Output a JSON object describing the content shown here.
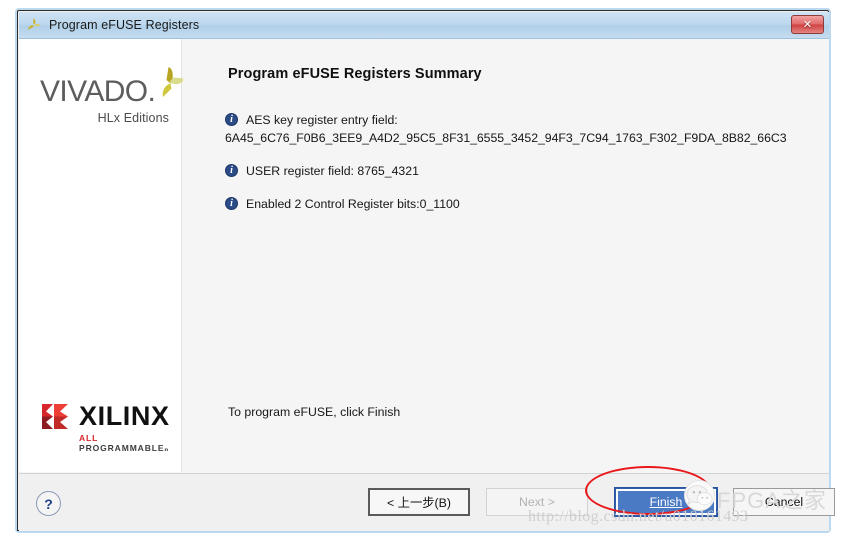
{
  "window": {
    "title": "Program eFUSE Registers",
    "app_icon": "vivado-flower-icon",
    "close_label": "✕"
  },
  "sidebar": {
    "vivado_logo": {
      "wordmark": "VIVADO",
      "dot": ".",
      "subtitle": "HLx Editions",
      "icon": "vivado-leaf-icon"
    },
    "xilinx_logo": {
      "wordmark": "XILINX",
      "tagline_red": "ALL",
      "tagline_rest": " PROGRAMMABLEₙ",
      "icon": "xilinx-x-icon"
    }
  },
  "content": {
    "page_title": "Program eFUSE Registers Summary",
    "info_items": [
      {
        "icon": "info-icon",
        "label": "AES key register entry field:",
        "value": "6A45_6C76_F0B6_3EE9_A4D2_95C5_8F31_6555_3452_94F3_7C94_1763_F302_F9DA_8B82_66C3"
      },
      {
        "icon": "info-icon",
        "label": "USER register field: 8765_4321",
        "value": ""
      },
      {
        "icon": "info-icon",
        "label": "Enabled 2 Control Register bits:0_1100",
        "value": ""
      }
    ],
    "hint": "To program eFUSE, click Finish"
  },
  "footer": {
    "help_label": "?",
    "buttons": {
      "back": "< 上一步(B)",
      "back_mnemonic": "B",
      "next": "Next >",
      "next_mnemonic": "N",
      "finish": "Finish",
      "finish_mnemonic": "F",
      "cancel": "Cancel"
    }
  },
  "annotations": {
    "highlight_shape": "red-ellipse-around-finish",
    "watermark_url": "http://blog.csdn.net/u010161493",
    "watermark_brand": "FPGA之家",
    "watermark_icon": "wechat-icon"
  },
  "colors": {
    "titlebar_top": "#cfe2f3",
    "titlebar_bottom": "#c6dcf0",
    "close_button": "#cf4040",
    "finish_button": "#4a7ac4",
    "info_icon": "#2b4b86",
    "annotation_red": "#e8181b",
    "sidebar_bg": "#ffffff",
    "content_bg": "#f5f5f5",
    "footer_bg": "#f0f0f0"
  }
}
